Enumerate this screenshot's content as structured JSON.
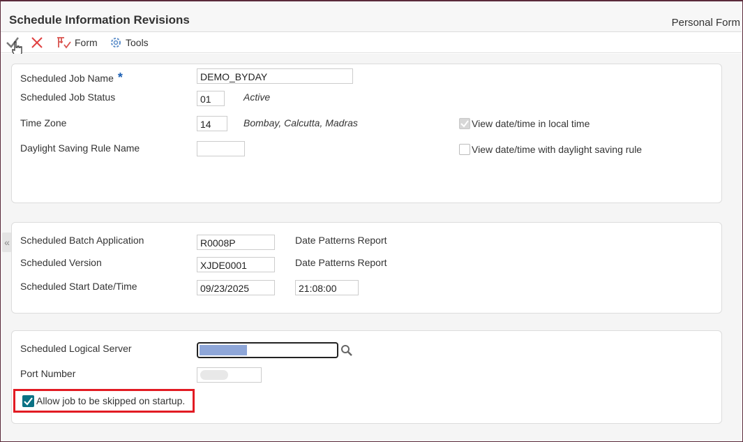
{
  "header": {
    "title": "Schedule Information Revisions",
    "personal_form": "Personal Form"
  },
  "toolbar": {
    "form_label": "Form",
    "tools_label": "Tools"
  },
  "panel1": {
    "job_name_label": "Scheduled Job Name",
    "job_name_value": "DEMO_BYDAY",
    "job_status_label": "Scheduled Job Status",
    "job_status_value": "01",
    "job_status_desc": "Active",
    "time_zone_label": "Time Zone",
    "time_zone_value": "14",
    "time_zone_desc": "Bombay, Calcutta, Madras",
    "dst_rule_label": "Daylight Saving Rule Name",
    "dst_rule_value": "",
    "local_time_label": "View date/time in local time",
    "local_time_checked": true,
    "dst_view_label": "View date/time with daylight saving rule",
    "dst_view_checked": false
  },
  "panel2": {
    "batch_app_label": "Scheduled Batch Application",
    "batch_app_value": "R0008P",
    "batch_app_desc": "Date Patterns Report",
    "version_label": "Scheduled Version",
    "version_value": "XJDE0001",
    "version_desc": "Date Patterns Report",
    "start_label": "Scheduled Start Date/Time",
    "start_date": "09/23/2025",
    "start_time": "21:08:00"
  },
  "panel3": {
    "server_label": "Scheduled Logical Server",
    "server_value": "",
    "port_label": "Port Number",
    "port_value": "",
    "skip_label": "Allow job to be skipped on startup.",
    "skip_checked": true
  },
  "colors": {
    "highlight_border": "#e21b23",
    "checkbox_checked": "#0b7285",
    "required_star": "#1a5fb4",
    "cancel_x": "#e04040"
  }
}
